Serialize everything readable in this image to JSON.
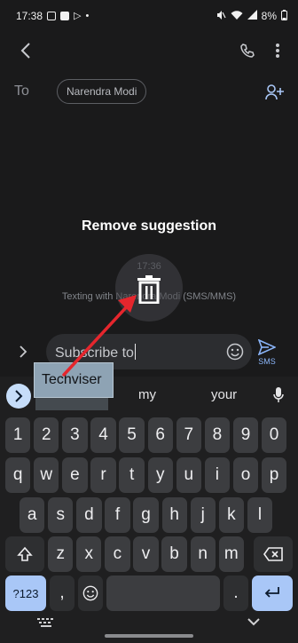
{
  "status_bar": {
    "time": "17:38",
    "battery": "8%",
    "dot": "•"
  },
  "recipient": {
    "to_label": "To",
    "chip": "Narendra Modi"
  },
  "conversation": {
    "time": "17:36",
    "texting_with": "Texting with Narendra Modi (SMS/MMS)"
  },
  "overlay": {
    "title": "Remove suggestion"
  },
  "compose": {
    "text": "Subscribe to",
    "send_label": "SMS"
  },
  "suggestions": {
    "dragged": "Techviser",
    "items": [
      "my",
      "your"
    ]
  },
  "keyboard": {
    "row1": [
      "1",
      "2",
      "3",
      "4",
      "5",
      "6",
      "7",
      "8",
      "9",
      "0"
    ],
    "row2": [
      "q",
      "w",
      "e",
      "r",
      "t",
      "y",
      "u",
      "i",
      "o",
      "p"
    ],
    "row3": [
      "a",
      "s",
      "d",
      "f",
      "g",
      "h",
      "j",
      "k",
      "l"
    ],
    "row4": [
      "z",
      "x",
      "c",
      "v",
      "b",
      "n",
      "m"
    ],
    "symbols_label": "?123",
    "comma": ",",
    "period": "."
  },
  "colors": {
    "background": "#1a1a1b",
    "key": "#3c3d40",
    "accent": "#a9c7f7",
    "annotation_arrow": "#e5262d"
  }
}
